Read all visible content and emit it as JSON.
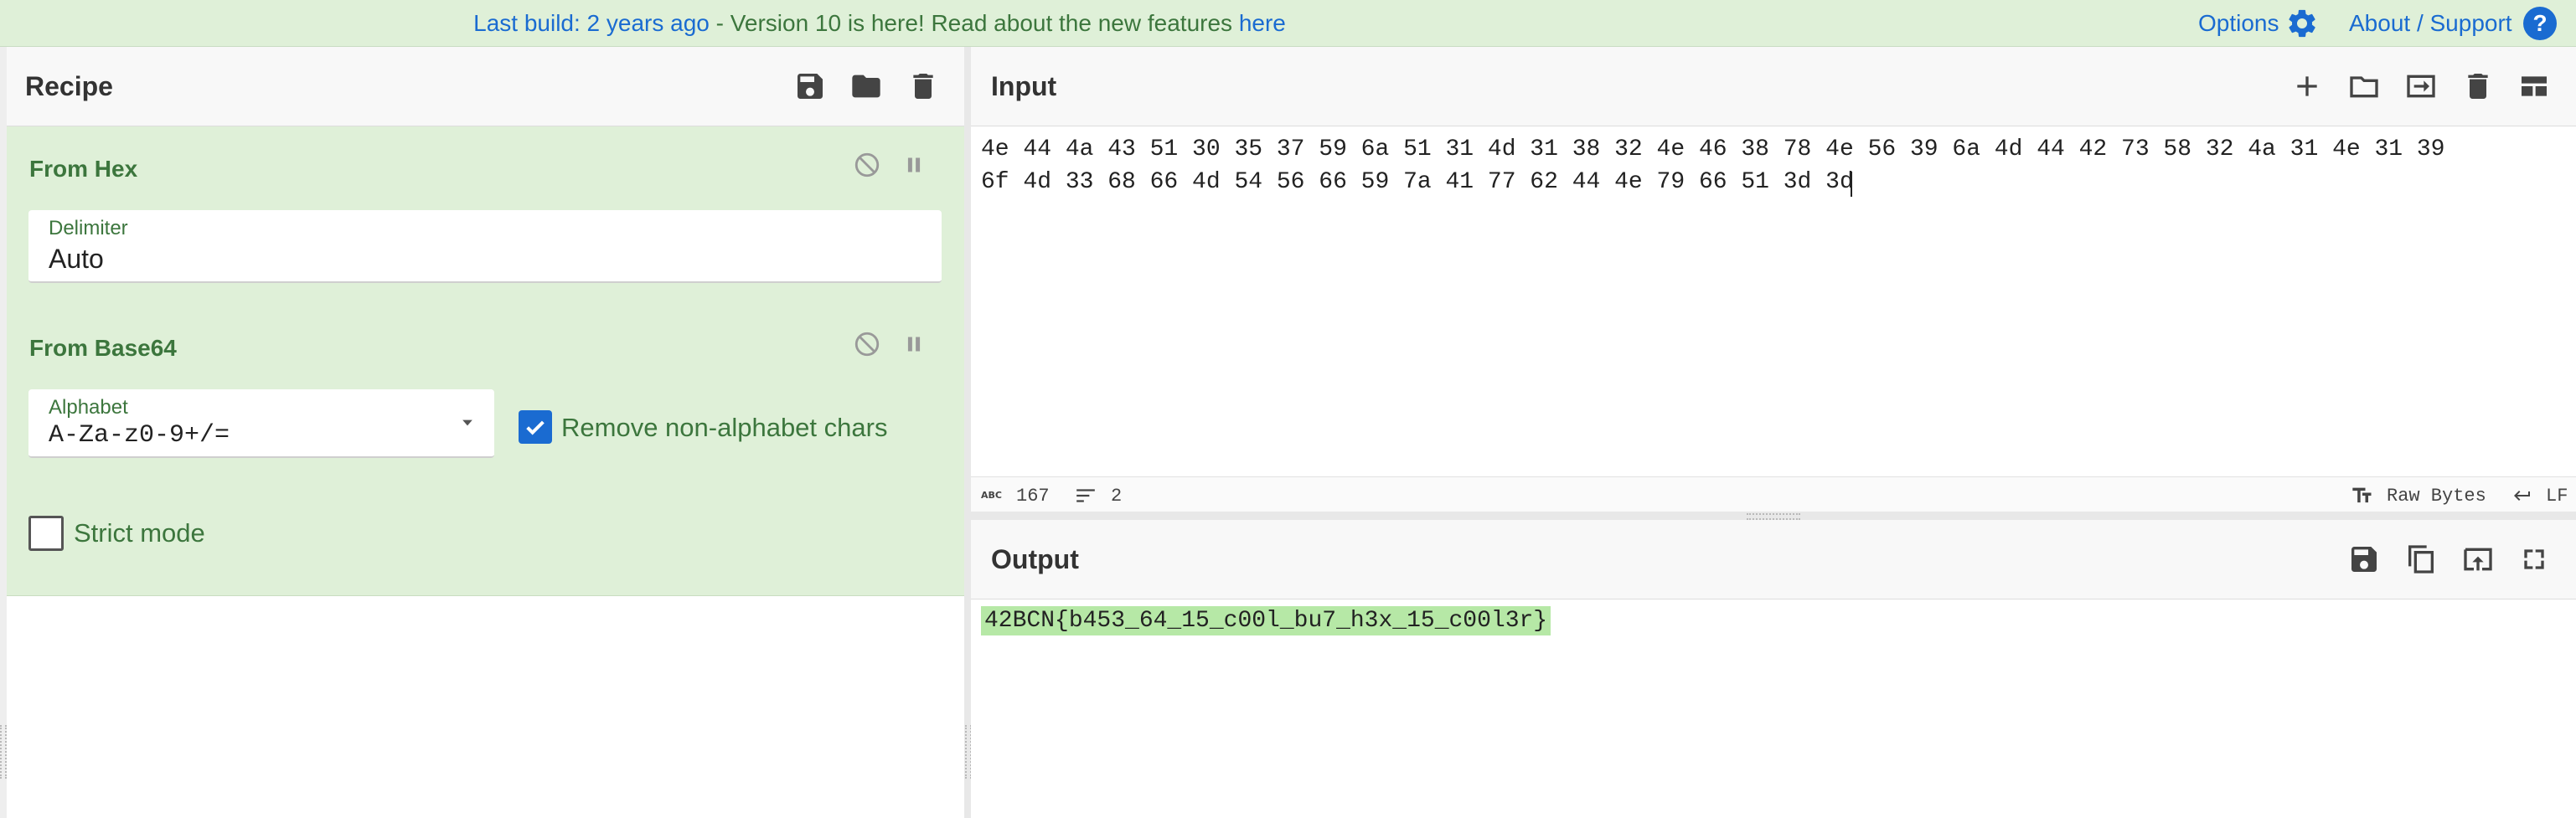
{
  "banner": {
    "build_link": "Last build: 2 years ago",
    "message": " - Version 10 is here! Read about the new features ",
    "here_link": "here",
    "options": "Options",
    "about": "About / Support",
    "help_glyph": "?"
  },
  "recipe": {
    "title": "Recipe",
    "operations": [
      {
        "title": "From Hex",
        "delimiter_label": "Delimiter",
        "delimiter_value": "Auto"
      },
      {
        "title": "From Base64",
        "alphabet_label": "Alphabet",
        "alphabet_value": "A-Za-z0-9+/=",
        "remove_non_alpha_label": "Remove non-alphabet chars",
        "remove_non_alpha_checked": true,
        "strict_mode_label": "Strict mode",
        "strict_mode_checked": false
      }
    ]
  },
  "input": {
    "title": "Input",
    "lines": [
      "4e 44 4a 43 51 30 35 37 59 6a 51 31 4d 31 38 32 4e 46 38 78 4e 56 39 6a 4d 44 42 73 58 32 4a 31 4e 31 39",
      "6f 4d 33 68 66 4d 54 56 66 59 7a 41 77 62 44 4e 79 66 51 3d 3d"
    ],
    "status": {
      "abc_icon": "ABC",
      "length": "167",
      "lines": "2",
      "encoding": "Raw Bytes",
      "eol": "LF"
    }
  },
  "output": {
    "title": "Output",
    "text": "42BCN{b453_64_15_c00l_bu7_h3x_15_c00l3r}"
  },
  "colors": {
    "banner_bg": "#dff0d8",
    "op_bg": "#dff0d8",
    "op_text": "#3c763d",
    "link": "#1a6bd1",
    "highlight": "#b6e8a6",
    "checkbox": "#1a6bd1"
  },
  "icons": {
    "recipe": [
      "save-icon",
      "folder-icon",
      "trash-icon"
    ],
    "operation": [
      "disable-icon",
      "pause-icon"
    ],
    "input": [
      "plus-icon",
      "folder-icon",
      "file-import-icon",
      "trash-icon",
      "layout-icon"
    ],
    "output": [
      "save-icon",
      "copy-icon",
      "replace-input-icon",
      "maximize-icon"
    ],
    "status": [
      "text-length-icon",
      "lines-icon",
      "font-icon",
      "eol-icon"
    ]
  }
}
